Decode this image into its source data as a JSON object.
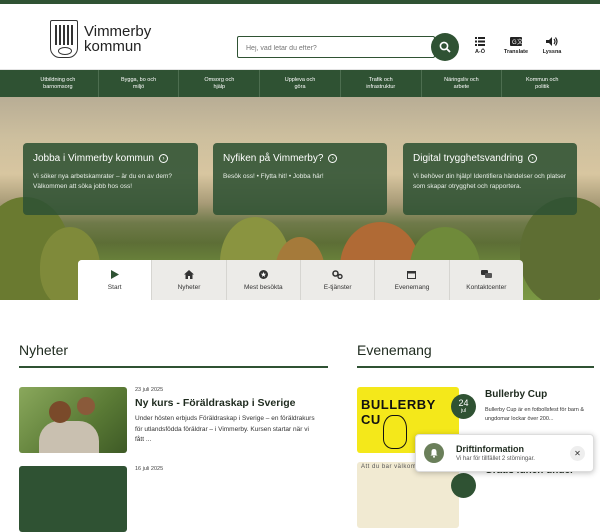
{
  "header": {
    "logo_line1": "Vimmerby",
    "logo_line2": "kommun",
    "search_placeholder": "Hej, vad letar du efter?",
    "tools": [
      {
        "icon": "list-icon",
        "label": "A-Ö"
      },
      {
        "icon": "translate-icon",
        "label": "Translate"
      },
      {
        "icon": "speaker-icon",
        "label": "Lyssna"
      }
    ]
  },
  "nav": [
    {
      "line1": "Utbildning och",
      "line2": "barnomsorg"
    },
    {
      "line1": "Bygga, bo och",
      "line2": "miljö"
    },
    {
      "line1": "Omsorg och",
      "line2": "hjälp"
    },
    {
      "line1": "Uppleva och",
      "line2": "göra"
    },
    {
      "line1": "Trafik och",
      "line2": "infrastruktur"
    },
    {
      "line1": "Näringsliv och",
      "line2": "arbete"
    },
    {
      "line1": "Kommun och",
      "line2": "politik"
    }
  ],
  "cards": [
    {
      "title": "Jobba i Vimmerby kommun",
      "text": "Vi söker nya arbetskamrater – är du en av dem? Välkommen att söka jobb hos oss!"
    },
    {
      "title": "Nyfiken på Vimmerby?",
      "text": "Besök oss! • Flytta hit! • Jobba här!"
    },
    {
      "title": "Digital trygghetsvandring",
      "text": "Vi behöver din hjälp! Identifiera händelser och platser som skapar otrygghet och rapportera."
    }
  ],
  "tabs": [
    {
      "icon": "play-icon",
      "label": "Start"
    },
    {
      "icon": "home-icon",
      "label": "Nyheter"
    },
    {
      "icon": "star-icon",
      "label": "Mest besökta"
    },
    {
      "icon": "gears-icon",
      "label": "E-tjänster"
    },
    {
      "icon": "calendar-icon",
      "label": "Evenemang"
    },
    {
      "icon": "chat-icon",
      "label": "Kontaktcenter"
    }
  ],
  "news": {
    "heading": "Nyheter",
    "items": [
      {
        "date": "23 juli 2025",
        "title": "Ny kurs - Föräldraskap i Sverige",
        "text": "Under hösten erbjuds Föräldraskap i Sverige – en föräldrakurs för utlandsfödda föräldrar – i Vimmerby. Kursen startar när vi fått ..."
      },
      {
        "date": "16 juli 2025",
        "title": "",
        "text": ""
      }
    ]
  },
  "events": {
    "heading": "Evenemang",
    "items": [
      {
        "day": "24",
        "month": "jul",
        "title": "Bullerby Cup",
        "text": "Bullerby Cup är en fotbollsfest för barn & ungdomar lockar över 200...",
        "img_text": "BULLERBY CU"
      },
      {
        "day": "",
        "month": "",
        "title": "Gratis lunch under",
        "text": "",
        "img_text": "Att du bar välkommen med ..."
      }
    ]
  },
  "toast": {
    "title": "Driftinformation",
    "text": "Vi har för tillfället 2 störningar.",
    "close": "✕"
  }
}
